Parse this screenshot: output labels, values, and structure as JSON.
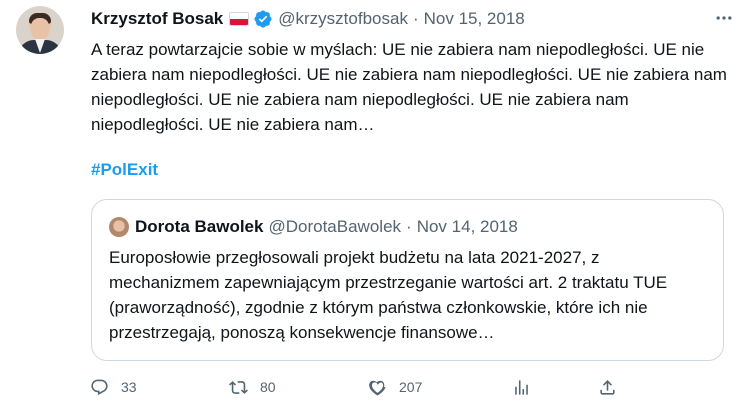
{
  "author": {
    "name": "Krzysztof Bosak",
    "handle": "@krzysztofbosak",
    "separator": "·",
    "date": "Nov 15, 2018"
  },
  "tweet": {
    "text": "A teraz powtarzajcie sobie w myślach: UE nie zabiera nam niepodległości. UE nie zabiera nam niepodległości. UE nie zabiera nam niepodległości. UE nie zabiera nam niepodległości. UE nie zabiera nam niepodległości. UE nie zabiera nam niepodległości. UE nie zabiera nam…",
    "hashtag": "#PolExit"
  },
  "quote": {
    "name": "Dorota Bawolek",
    "handle": "@DorotaBawolek",
    "separator": "·",
    "date": "Nov 14, 2018",
    "text": "Europosłowie przegłosowali projekt budżetu na lata 2021-2027, z mechanizmem zapewniającym przestrzeganie wartości art. 2 traktatu TUE (praworządność), zgodnie z którym państwa członkowskie, które ich nie przestrzegają, ponoszą konsekwencje finansowe…"
  },
  "actions": {
    "replies": "33",
    "retweets": "80",
    "likes": "207"
  },
  "colors": {
    "link": "#1d9bf0",
    "secondary_text": "#536471",
    "border": "#cfd9de",
    "verified": "#1d9bf0",
    "flag_red": "#dc143c"
  },
  "icons": [
    "more-icon",
    "verified-badge-icon",
    "polish-flag-icon",
    "reply-icon",
    "retweet-icon",
    "like-icon",
    "views-icon",
    "share-icon"
  ]
}
